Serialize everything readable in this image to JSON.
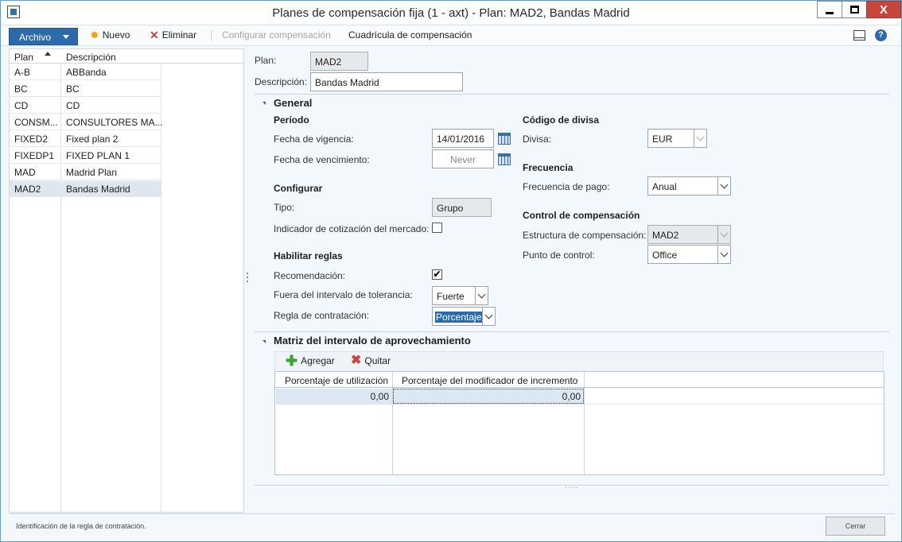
{
  "window": {
    "title": "Planes de compensación fija (1 - axt) - Plan: MAD2, Bandas Madrid",
    "close_glyph": "X"
  },
  "toolbar": {
    "archivo": "Archivo",
    "nuevo": "Nuevo",
    "eliminar": "Eliminar",
    "configurar": "Configurar compensación",
    "cuadricula": "Cuadrícula de compensación",
    "help_glyph": "?"
  },
  "list": {
    "columns": [
      "Plan",
      "Descripción"
    ],
    "rows": [
      {
        "plan": "A-B",
        "desc": "ABBanda"
      },
      {
        "plan": "BC",
        "desc": "BC"
      },
      {
        "plan": "CD",
        "desc": "CD"
      },
      {
        "plan": "CONSM...",
        "desc": "CONSULTORES MA..."
      },
      {
        "plan": "FIXED2",
        "desc": "Fixed plan 2"
      },
      {
        "plan": "FIXEDP1",
        "desc": "FIXED PLAN 1"
      },
      {
        "plan": "MAD",
        "desc": "Madrid Plan"
      },
      {
        "plan": "MAD2",
        "desc": "Bandas Madrid"
      }
    ],
    "selected_plan": "MAD2"
  },
  "header": {
    "plan_label": "Plan:",
    "plan_value": "MAD2",
    "desc_label": "Descripción:",
    "desc_value": "Bandas Madrid"
  },
  "general": {
    "title": "General",
    "periodo": "Período",
    "vigencia_label": "Fecha de vigencia:",
    "vigencia_value": "14/01/2016",
    "vencimiento_label": "Fecha de vencimiento:",
    "vencimiento_value": "Never",
    "configurar": "Configurar",
    "tipo_label": "Tipo:",
    "tipo_value": "Grupo",
    "indicador_label": "Indicador de cotización del mercado:",
    "indicador_checked": false,
    "habilitar": "Habilitar reglas",
    "recomendacion_label": "Recomendación:",
    "recomendacion_mark": "✔",
    "fuera_label": "Fuera del intervalo de tolerancia:",
    "fuera_value": "Fuerte",
    "regla_label": "Regla de contratación:",
    "regla_value": "Porcentaje",
    "codigo_divisa": "Código de divisa",
    "divisa_label": "Divisa:",
    "divisa_value": "EUR",
    "frecuencia": "Frecuencia",
    "frecuencia_label": "Frecuencia de pago:",
    "frecuencia_value": "Anual",
    "control": "Control de compensación",
    "estructura_label": "Estructura de compensación:",
    "estructura_value": "MAD2",
    "punto_label": "Punto de control:",
    "punto_value": "Office"
  },
  "matriz": {
    "title": "Matriz del intervalo de aprovechamiento",
    "agregar": "Agregar",
    "quitar": "Quitar",
    "columns": [
      "Porcentaje de utilización",
      "Porcentaje del modificador de incremento"
    ],
    "row": {
      "utilizacion": "0,00",
      "modificador": "0,00"
    }
  },
  "status": {
    "text": "Identificación de la regla de contratación.",
    "close": "Cerrar"
  },
  "colors": {
    "accent": "#2d6aa9",
    "window_border": "#4fa3e0",
    "close_red": "#c7463b",
    "background": "#f3f8fc"
  }
}
